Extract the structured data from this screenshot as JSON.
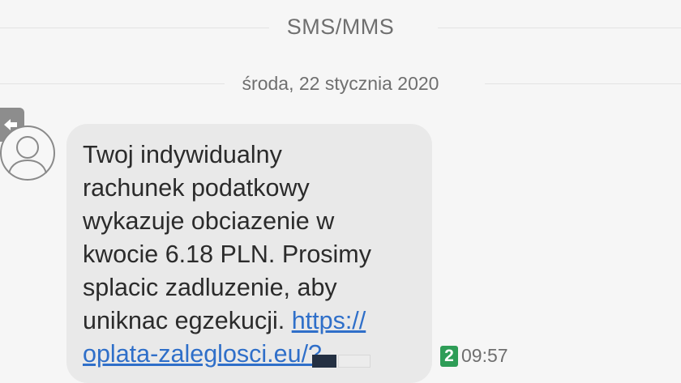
{
  "header": {
    "channel_label": "SMS/MMS"
  },
  "conversation": {
    "date_label": "środa, 22 stycznia 2020",
    "message": {
      "text_lines": "Twoj indywidualny\nrachunek podatkowy\nwykazuje obciazenie w\nkwocie 6.18 PLN. Prosimy\nsplacic zadluzenie, aby\nuniknac egzekucji. ",
      "link_text": "https://\noplata-zaleglosci.eu/?",
      "sim_badge": "2",
      "time": "09:57"
    },
    "icons": {
      "avatar": "contact-avatar-icon",
      "side_tab": "back-arrow-icon"
    }
  },
  "colors": {
    "background": "#f6f6f6",
    "bubble": "#e9e9e9",
    "link": "#2f6fc9",
    "sim_badge": "#2e9d57",
    "muted_text": "#6f6f6f"
  }
}
